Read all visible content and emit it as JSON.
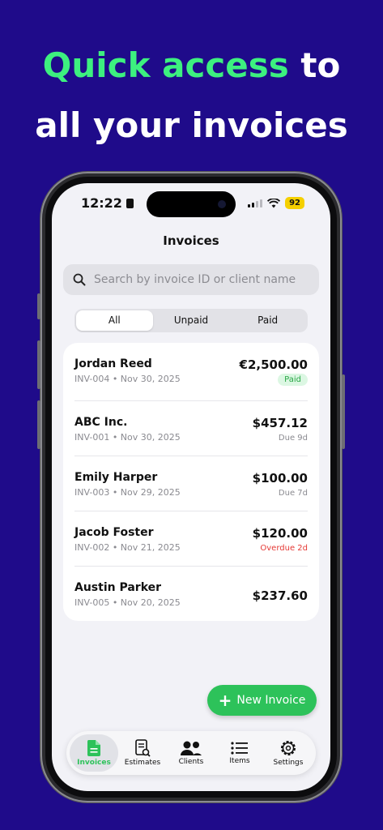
{
  "headline": {
    "line1_accent": "Quick access",
    "line1_rest": " to",
    "line2": "all your invoices"
  },
  "status_bar": {
    "time": "12:22",
    "battery": "92"
  },
  "nav": {
    "title": "Invoices"
  },
  "search": {
    "placeholder": "Search by invoice ID or client name",
    "value": ""
  },
  "segments": {
    "all": "All",
    "unpaid": "Unpaid",
    "paid": "Paid",
    "selected": "All"
  },
  "invoices": [
    {
      "name": "Jordan Reed",
      "meta": "INV-004 • Nov 30, 2025",
      "amount": "€2,500.00",
      "status": "Paid",
      "status_type": "paid"
    },
    {
      "name": "ABC Inc.",
      "meta": "INV-001 • Nov 30, 2025",
      "amount": "$457.12",
      "status": "Due 9d",
      "status_type": "due"
    },
    {
      "name": "Emily Harper",
      "meta": "INV-003 • Nov 29, 2025",
      "amount": "$100.00",
      "status": "Due 7d",
      "status_type": "due"
    },
    {
      "name": "Jacob Foster",
      "meta": "INV-002 • Nov 21, 2025",
      "amount": "$120.00",
      "status": "Overdue 2d",
      "status_type": "overdue"
    },
    {
      "name": "Austin Parker",
      "meta": "INV-005 • Nov 20, 2025",
      "amount": "$237.60",
      "status": "",
      "status_type": "none"
    }
  ],
  "fab": {
    "label": "New Invoice",
    "icon": "plus-icon"
  },
  "tabs": [
    {
      "label": "Invoices",
      "icon": "document-icon",
      "active": true
    },
    {
      "label": "Estimates",
      "icon": "estimate-icon",
      "active": false
    },
    {
      "label": "Clients",
      "icon": "people-icon",
      "active": false
    },
    {
      "label": "Items",
      "icon": "list-icon",
      "active": false
    },
    {
      "label": "Settings",
      "icon": "gear-icon",
      "active": false
    }
  ],
  "colors": {
    "background": "#1f0b8a",
    "accent_green": "#3df07f",
    "button_green": "#2dc25a",
    "overdue_red": "#e53935",
    "battery_yellow": "#f5d000"
  }
}
